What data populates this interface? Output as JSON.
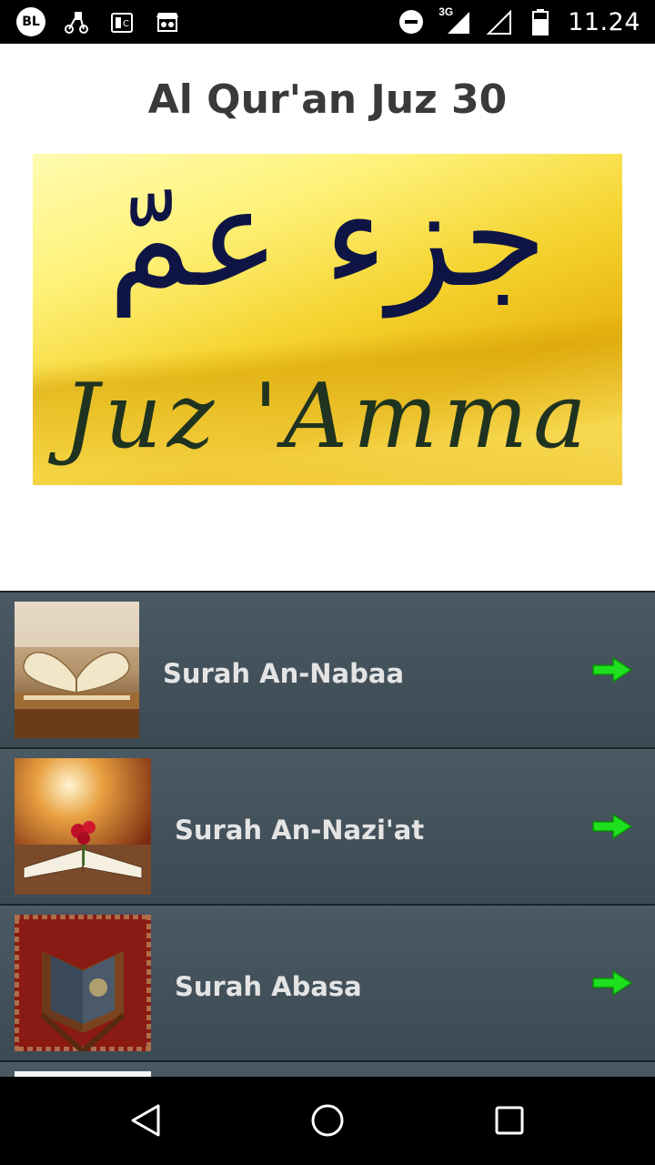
{
  "status_bar": {
    "notification_badge": "BL",
    "network_type": "3G",
    "time": "11.24"
  },
  "header": {
    "title": "Al Qur'an Juz 30"
  },
  "banner": {
    "arabic_text": "جزء عمّ",
    "latin_text": "Juz 'Amma"
  },
  "surah_list": [
    {
      "label": "Surah An-Nabaa",
      "thumbnail": "heart-book-image"
    },
    {
      "label": "Surah An-Nazi'at",
      "thumbnail": "quran-roses-image"
    },
    {
      "label": "Surah Abasa",
      "thumbnail": "quran-stand-image"
    }
  ],
  "icons": {
    "arrow_color": "#1fe01f",
    "row_color": "#3f4d57"
  }
}
